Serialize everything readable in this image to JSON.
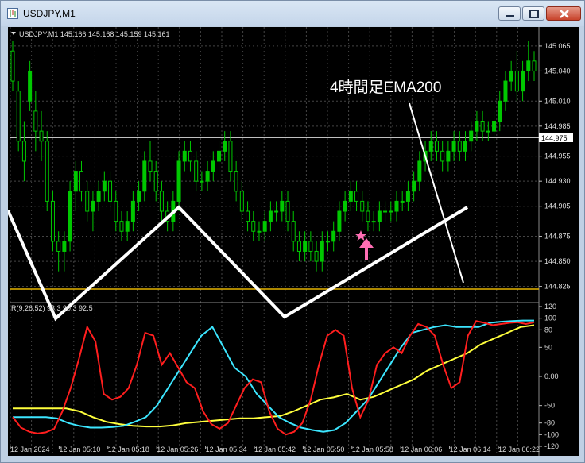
{
  "window": {
    "title": "USDJPY,M1"
  },
  "chart": {
    "header": "USDJPY,M1  145.166 145.168 145.159 145.161",
    "price_labels": [
      "145.065",
      "145.040",
      "145.010",
      "144.985",
      "144.955",
      "144.930",
      "144.905",
      "144.875",
      "144.850",
      "144.825"
    ],
    "current_price": "144.975",
    "annotation": "4時間足EMA200",
    "indicator_header": "R(9,26,52) 93.3 90.3 92.5",
    "indicator_labels": [
      "120",
      "100",
      "80",
      "50",
      "0.00",
      "-50",
      "-80",
      "-100",
      "-120"
    ],
    "time_labels": [
      "12 Jan 2024",
      "12 Jan 05:10",
      "12 Jan 05:18",
      "12 Jan 05:26",
      "12 Jan 05:34",
      "12 Jan 05:42",
      "12 Jan 05:50",
      "12 Jan 05:58",
      "12 Jan 06:06",
      "12 Jan 06:14",
      "12 Jan 06:22"
    ],
    "colors": {
      "candle": "#00c800",
      "ema_line": "#ffffff",
      "level_line": "#e6b400",
      "red": "#ff1e1e",
      "cyan": "#3ce6ff",
      "yellow": "#ffff3c",
      "arrow": "#ff6eb4"
    }
  },
  "chart_data": {
    "type": "candlestick",
    "price_axis": {
      "min": 144.812,
      "max": 145.08
    },
    "candles": [
      [
        145.06,
        145.07,
        145.02,
        145.03
      ],
      [
        145.02,
        145.03,
        144.96,
        144.97
      ],
      [
        144.97,
        144.99,
        144.93,
        144.95
      ],
      [
        145.01,
        145.05,
        145.0,
        145.04
      ],
      [
        145.0,
        145.02,
        144.96,
        144.98
      ],
      [
        144.98,
        145.0,
        144.95,
        144.97
      ],
      [
        144.97,
        144.98,
        144.9,
        144.91
      ],
      [
        144.91,
        144.92,
        144.86,
        144.87
      ],
      [
        144.87,
        144.88,
        144.84,
        144.86
      ],
      [
        144.86,
        144.88,
        144.84,
        144.87
      ],
      [
        144.87,
        144.93,
        144.86,
        144.92
      ],
      [
        144.92,
        144.95,
        144.9,
        144.94
      ],
      [
        144.94,
        144.95,
        144.91,
        144.92
      ],
      [
        144.92,
        144.93,
        144.89,
        144.9
      ],
      [
        144.9,
        144.92,
        144.88,
        144.91
      ],
      [
        144.91,
        144.93,
        144.9,
        144.92
      ],
      [
        144.92,
        144.94,
        144.91,
        144.93
      ],
      [
        144.93,
        144.94,
        144.9,
        144.91
      ],
      [
        144.91,
        144.92,
        144.88,
        144.89
      ],
      [
        144.89,
        144.9,
        144.87,
        144.88
      ],
      [
        144.88,
        144.9,
        144.87,
        144.89
      ],
      [
        144.89,
        144.92,
        144.88,
        144.91
      ],
      [
        144.91,
        144.93,
        144.9,
        144.92
      ],
      [
        144.92,
        144.96,
        144.91,
        144.95
      ],
      [
        144.95,
        144.97,
        144.93,
        144.94
      ],
      [
        144.94,
        144.95,
        144.91,
        144.92
      ],
      [
        144.92,
        144.93,
        144.89,
        144.9
      ],
      [
        144.9,
        144.91,
        144.88,
        144.89
      ],
      [
        144.89,
        144.92,
        144.88,
        144.91
      ],
      [
        144.91,
        144.96,
        144.9,
        144.95
      ],
      [
        144.95,
        144.97,
        144.94,
        144.96
      ],
      [
        144.96,
        144.97,
        144.94,
        144.95
      ],
      [
        144.95,
        144.96,
        144.92,
        144.93
      ],
      [
        144.93,
        144.94,
        144.92,
        144.93
      ],
      [
        144.93,
        144.95,
        144.92,
        144.94
      ],
      [
        144.94,
        144.96,
        144.93,
        144.95
      ],
      [
        144.95,
        144.97,
        144.94,
        144.96
      ],
      [
        144.96,
        144.98,
        144.95,
        144.97
      ],
      [
        144.97,
        144.98,
        144.93,
        144.94
      ],
      [
        144.94,
        144.95,
        144.91,
        144.92
      ],
      [
        144.92,
        144.93,
        144.89,
        144.9
      ],
      [
        144.9,
        144.91,
        144.88,
        144.89
      ],
      [
        144.89,
        144.9,
        144.87,
        144.88
      ],
      [
        144.88,
        144.89,
        144.87,
        144.88
      ],
      [
        144.88,
        144.9,
        144.87,
        144.89
      ],
      [
        144.89,
        144.91,
        144.88,
        144.9
      ],
      [
        144.9,
        144.91,
        144.89,
        144.9
      ],
      [
        144.9,
        144.92,
        144.89,
        144.91
      ],
      [
        144.91,
        144.92,
        144.88,
        144.89
      ],
      [
        144.89,
        144.9,
        144.86,
        144.87
      ],
      [
        144.87,
        144.88,
        144.85,
        144.86
      ],
      [
        144.86,
        144.88,
        144.85,
        144.87
      ],
      [
        144.87,
        144.88,
        144.85,
        144.86
      ],
      [
        144.86,
        144.87,
        144.84,
        144.85
      ],
      [
        144.85,
        144.88,
        144.84,
        144.87
      ],
      [
        144.87,
        144.88,
        144.86,
        144.87
      ],
      [
        144.87,
        144.89,
        144.86,
        144.88
      ],
      [
        144.88,
        144.91,
        144.87,
        144.9
      ],
      [
        144.9,
        144.92,
        144.89,
        144.91
      ],
      [
        144.91,
        144.93,
        144.9,
        144.92
      ],
      [
        144.92,
        144.93,
        144.9,
        144.91
      ],
      [
        144.91,
        144.92,
        144.89,
        144.9
      ],
      [
        144.9,
        144.91,
        144.88,
        144.89
      ],
      [
        144.89,
        144.9,
        144.88,
        144.89
      ],
      [
        144.89,
        144.91,
        144.88,
        144.9
      ],
      [
        144.9,
        144.91,
        144.89,
        144.9
      ],
      [
        144.9,
        144.91,
        144.89,
        144.9
      ],
      [
        144.9,
        144.92,
        144.89,
        144.91
      ],
      [
        144.91,
        144.92,
        144.9,
        144.91
      ],
      [
        144.91,
        144.93,
        144.9,
        144.92
      ],
      [
        144.92,
        144.94,
        144.91,
        144.93
      ],
      [
        144.93,
        144.96,
        144.92,
        144.95
      ],
      [
        144.95,
        144.97,
        144.94,
        144.96
      ],
      [
        144.96,
        144.98,
        144.95,
        144.97
      ],
      [
        144.97,
        144.98,
        144.95,
        144.96
      ],
      [
        144.96,
        144.97,
        144.94,
        144.95
      ],
      [
        144.95,
        144.97,
        144.94,
        144.96
      ],
      [
        144.96,
        144.98,
        144.95,
        144.97
      ],
      [
        144.97,
        144.98,
        144.95,
        144.96
      ],
      [
        144.96,
        144.98,
        144.95,
        144.97
      ],
      [
        144.97,
        144.99,
        144.96,
        144.98
      ],
      [
        144.98,
        145.0,
        144.97,
        144.99
      ],
      [
        144.99,
        145.0,
        144.97,
        144.98
      ],
      [
        144.98,
        144.99,
        144.97,
        144.98
      ],
      [
        144.98,
        145.0,
        144.97,
        144.99
      ],
      [
        144.99,
        145.02,
        144.98,
        145.01
      ],
      [
        145.01,
        145.04,
        145.0,
        145.03
      ],
      [
        145.03,
        145.05,
        145.02,
        145.04
      ],
      [
        145.04,
        145.06,
        145.01,
        145.02
      ],
      [
        145.02,
        145.05,
        145.01,
        145.04
      ],
      [
        145.04,
        145.07,
        145.03,
        145.05
      ],
      [
        145.05,
        145.06,
        145.03,
        145.04
      ]
    ],
    "oscillator": {
      "ylim": [
        -120,
        120
      ],
      "red": [
        -70,
        -88,
        -95,
        -98,
        -96,
        -90,
        -60,
        -20,
        30,
        85,
        60,
        -30,
        -40,
        -35,
        -20,
        20,
        75,
        70,
        20,
        40,
        15,
        -10,
        -20,
        -60,
        -82,
        -90,
        -80,
        -50,
        -20,
        -5,
        -10,
        -60,
        -90,
        -100,
        -95,
        -80,
        -40,
        20,
        70,
        80,
        70,
        -20,
        -70,
        -40,
        20,
        40,
        50,
        40,
        70,
        90,
        85,
        70,
        20,
        -20,
        -10,
        70,
        95,
        92,
        88,
        90,
        92,
        93,
        90,
        93
      ],
      "cyan": [
        -70,
        -70,
        -70,
        -70,
        -72,
        -80,
        -85,
        -88,
        -88,
        -87,
        -85,
        -78,
        -70,
        -50,
        -20,
        10,
        40,
        70,
        85,
        50,
        15,
        0,
        -30,
        -50,
        -70,
        -80,
        -88,
        -92,
        -95,
        -92,
        -80,
        -60,
        -40,
        -10,
        20,
        50,
        75,
        80,
        85,
        88,
        85,
        85,
        85,
        92,
        94,
        95,
        96,
        96
      ],
      "yellow": [
        -55,
        -55,
        -55,
        -55,
        -55,
        -60,
        -70,
        -78,
        -82,
        -85,
        -86,
        -86,
        -84,
        -80,
        -78,
        -76,
        -74,
        -72,
        -72,
        -70,
        -68,
        -60,
        -50,
        -40,
        -36,
        -30,
        -40,
        -35,
        -25,
        -15,
        -5,
        10,
        20,
        30,
        40,
        55,
        65,
        75,
        85,
        88
      ]
    }
  }
}
